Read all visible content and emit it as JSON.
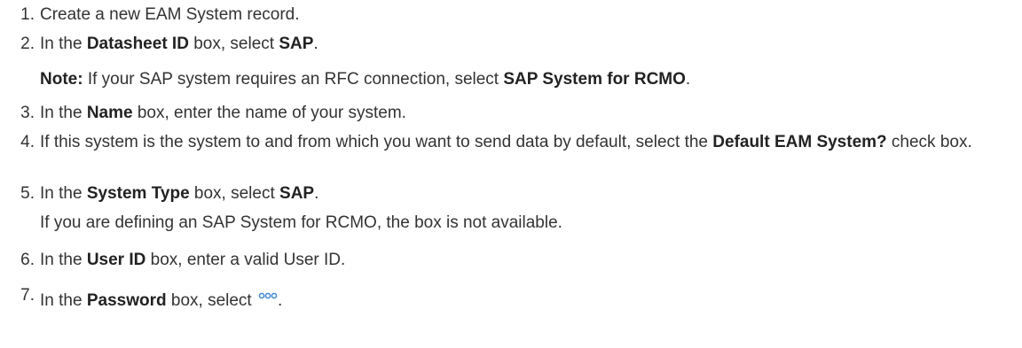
{
  "steps": [
    {
      "num": "1.",
      "text": "Create a new EAM System record."
    },
    {
      "num": "2.",
      "pre": "In the ",
      "bold": "Datasheet ID",
      "mid": " box, select ",
      "bold2": "SAP",
      "post": "."
    },
    {
      "num": "3.",
      "pre": "In the ",
      "bold": "Name",
      "post": " box, enter the name of your system."
    },
    {
      "num": "4.",
      "pre": "If this system is the system to and from which you want to send data by default, select the ",
      "bold": "Default EAM System?",
      "post": " check box."
    },
    {
      "num": "5.",
      "pre": "In the ",
      "bold": "System Type",
      "mid": " box, select ",
      "bold2": "SAP",
      "post": "."
    },
    {
      "num": "6.",
      "pre": "In the ",
      "bold": "User ID",
      "post": " box, enter a valid User ID."
    },
    {
      "num": "7.",
      "pre": "In the ",
      "bold": "Password",
      "mid": " box, select ",
      "post": "."
    }
  ],
  "note": {
    "label": "Note:",
    "pre": " If your SAP system requires an RFC connection, select ",
    "bold": "SAP System for RCMO",
    "post": "."
  },
  "step5_sub": "If you are defining an SAP System for RCMO, the box is not available.",
  "icons": {
    "password_select": "ellipsis-dots-icon",
    "dot_color": "#4a8fd8"
  }
}
